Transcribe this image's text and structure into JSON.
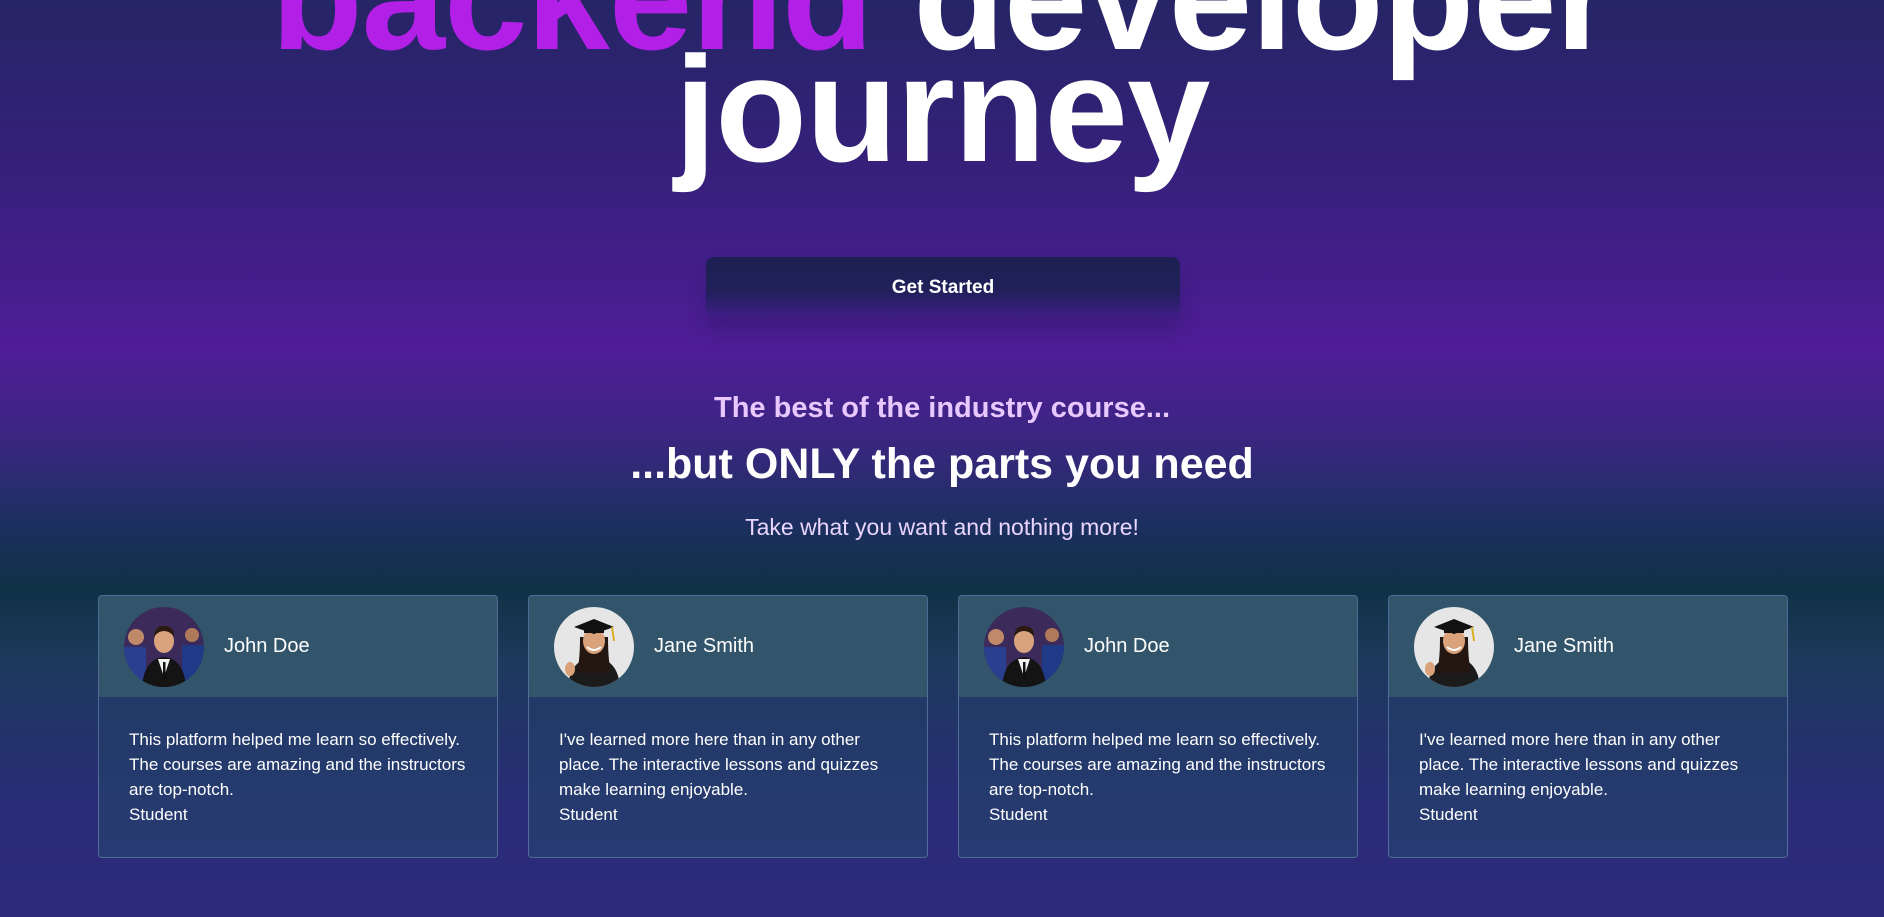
{
  "hero": {
    "top_accent": "backend",
    "top_rest": "developer",
    "headline_last": "journey"
  },
  "cta": {
    "label": "Get Started"
  },
  "taglines": {
    "line1": "The best of the industry course...",
    "line2": "...but ONLY the parts you need",
    "line3": "Take what you want and nothing more!"
  },
  "testimonials": [
    {
      "name": "John Doe",
      "quote": "This platform helped me learn so effectively. The courses are amazing and the instructors are top-notch.",
      "role": "Student",
      "avatar": "male-graduate-avatar"
    },
    {
      "name": "Jane Smith",
      "quote": "I've learned more here than in any other place. The interactive lessons and quizzes make learning enjoyable.",
      "role": "Student",
      "avatar": "female-graduate-avatar"
    },
    {
      "name": "John Doe",
      "quote": "This platform helped me learn so effectively. The courses are amazing and the instructors are top-notch.",
      "role": "Student",
      "avatar": "male-graduate-avatar"
    },
    {
      "name": "Jane Smith",
      "quote": "I've learned more here than in any other place. The interactive lessons and quizzes make learning enjoyable.",
      "role": "Student",
      "avatar": "female-graduate-avatar"
    }
  ],
  "colors": {
    "accent": "#b21fe6",
    "tagline_highlight": "#e9c7ff",
    "card_header": "#32556b"
  }
}
